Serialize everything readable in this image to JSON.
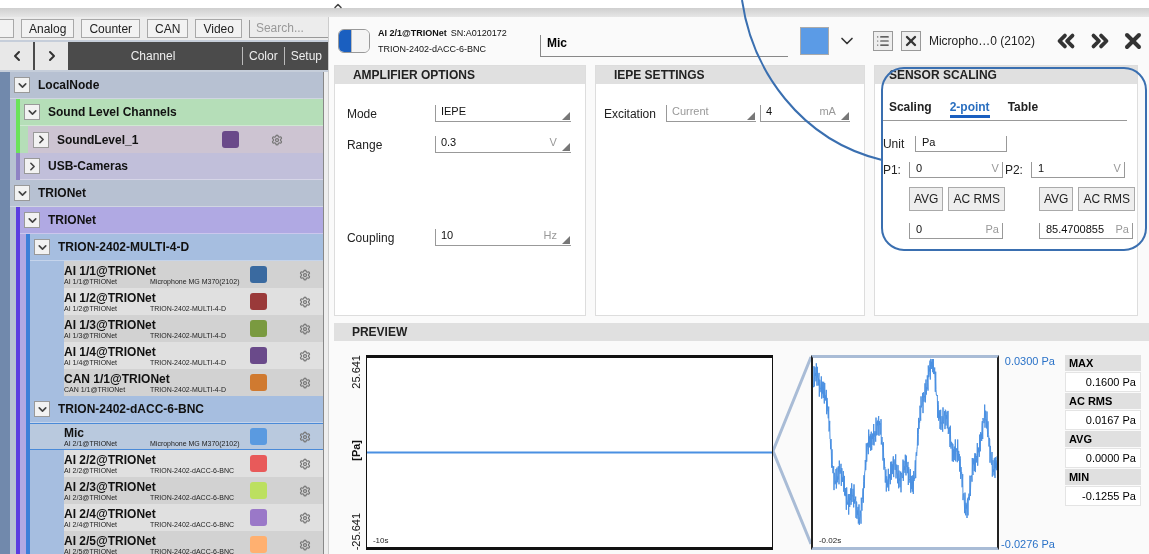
{
  "filters": {
    "buttons": [
      "Analog",
      "Counter",
      "CAN",
      "Video"
    ],
    "search": {
      "placeholder": "Search..."
    }
  },
  "channel_list": {
    "columns": [
      "Channel",
      "Color",
      "Setup"
    ],
    "tree": [
      {
        "kind": "group",
        "label": "LocalNode",
        "expanded": true,
        "color": "#7189ac",
        "children": [
          {
            "kind": "group",
            "label": "Sound Level Channels",
            "expanded": true,
            "color": "#6be35a",
            "children": [
              {
                "kind": "channel",
                "name": "SoundLevel_1",
                "expanded": false,
                "color": "#6a4a8a",
                "selected": false
              }
            ]
          },
          {
            "kind": "group",
            "label": "USB-Cameras",
            "expanded": false,
            "color": "#8f82c4"
          }
        ]
      },
      {
        "kind": "group",
        "label": "TRIONet",
        "expanded": true,
        "color": "#7189ac",
        "children": [
          {
            "kind": "group",
            "label": "TRIONet",
            "expanded": true,
            "color": "#5b3ce0",
            "children": [
              {
                "kind": "group",
                "label": "TRION-2402-MULTI-4-D",
                "expanded": true,
                "color": "#3c7fd8",
                "children": [
                  {
                    "kind": "channel",
                    "name": "AI 1/1@TRIONet",
                    "address": "AI 1/1@TRIONet",
                    "device": "Microphone MG M370(2102)",
                    "color": "#3a6aa0",
                    "selected": false
                  },
                  {
                    "kind": "channel",
                    "name": "AI 1/2@TRIONet",
                    "address": "AI 1/2@TRIONet",
                    "device": "TRION-2402-MULTI-4-D",
                    "color": "#9a3a3a",
                    "selected": false
                  },
                  {
                    "kind": "channel",
                    "name": "AI 1/3@TRIONet",
                    "address": "AI 1/3@TRIONet",
                    "device": "TRION-2402-MULTI-4-D",
                    "color": "#7a9a40",
                    "selected": false
                  },
                  {
                    "kind": "channel",
                    "name": "AI 1/4@TRIONet",
                    "address": "AI 1/4@TRIONet",
                    "device": "TRION-2402-MULTI-4-D",
                    "color": "#6a4a8a",
                    "selected": false
                  },
                  {
                    "kind": "channel",
                    "name": "CAN 1/1@TRIONet",
                    "address": "CAN 1/1@TRIONet",
                    "device": "TRION-2402-MULTI-4-D",
                    "color": "#d07a30",
                    "selected": false
                  }
                ]
              },
              {
                "kind": "group",
                "label": "TRION-2402-dACC-6-BNC",
                "expanded": true,
                "color": "#3c7fd8",
                "children": [
                  {
                    "kind": "channel",
                    "name": "Mic",
                    "address": "AI 2/1@TRIONet",
                    "device": "Microphone MG M370(2102)",
                    "color": "#5a9ae0",
                    "selected": true
                  },
                  {
                    "kind": "channel",
                    "name": "AI 2/2@TRIONet",
                    "address": "AI 2/2@TRIONet",
                    "device": "TRION-2402-dACC-6-BNC",
                    "color": "#e85a5a",
                    "selected": false
                  },
                  {
                    "kind": "channel",
                    "name": "AI 2/3@TRIONet",
                    "address": "AI 2/3@TRIONet",
                    "device": "TRION-2402-dACC-6-BNC",
                    "color": "#bce060",
                    "selected": false
                  },
                  {
                    "kind": "channel",
                    "name": "AI 2/4@TRIONet",
                    "address": "AI 2/4@TRIONet",
                    "device": "TRION-2402-dACC-6-BNC",
                    "color": "#9a78c8",
                    "selected": false
                  },
                  {
                    "kind": "channel",
                    "name": "AI 2/5@TRIONet",
                    "address": "AI 2/5@TRIONet",
                    "device": "TRION-2402-dACC-6-BNC",
                    "color": "#ffb070",
                    "selected": false
                  }
                ]
              }
            ]
          }
        ]
      }
    ]
  },
  "channel_header": {
    "enabled": true,
    "title": "AI 2/1@TRIONet",
    "serial": "SN:A0120172",
    "device": "TRION-2402-dACC-6-BNC",
    "name": "Mic",
    "color": "#5b9be6",
    "sensor": "Micropho…0 (2102)"
  },
  "amplifier_options": {
    "title": "AMPLIFIER OPTIONS",
    "fields": [
      {
        "label": "Mode",
        "value": "IEPE"
      },
      {
        "label": "Range",
        "value": "0.3",
        "unit": "V"
      },
      {
        "label": "Coupling",
        "value": "10",
        "unit": "Hz"
      }
    ]
  },
  "iepe_settings": {
    "title": "IEPE SETTINGS",
    "label": "Excitation",
    "mode": {
      "value": "Current",
      "disabled": true
    },
    "value": "4",
    "unit": "mA"
  },
  "sensor_scaling": {
    "title": "SENSOR SCALING",
    "tabs": [
      {
        "label": "Scaling",
        "selected": false
      },
      {
        "label": "2-point",
        "selected": true
      },
      {
        "label": "Table",
        "selected": false
      }
    ],
    "unit_label": "Unit",
    "unit": "Pa",
    "points": [
      {
        "label": "P1:",
        "value": "0",
        "unit": "V",
        "buttons": [
          "AVG",
          "AC RMS"
        ],
        "scaled": "0",
        "scaled_unit": "Pa"
      },
      {
        "label": "P2:",
        "value": "1",
        "unit": "V",
        "buttons": [
          "AVG",
          "AC RMS"
        ],
        "scaled": "85.4700855",
        "scaled_unit": "Pa"
      }
    ]
  },
  "preview": {
    "title": "PREVIEW",
    "y_max": "25.641",
    "y_unit": "[Pa]",
    "y_min": "-25.641",
    "time": "-10s",
    "zoom_time": "-0.02s",
    "zoom_max": "0.0300 Pa",
    "zoom_min": "-0.0276 Pa",
    "stats": [
      {
        "label": "MAX",
        "value": "0.1600 Pa"
      },
      {
        "label": "AC RMS",
        "value": "0.0167 Pa"
      },
      {
        "label": "AVG",
        "value": "0.0000 Pa"
      },
      {
        "label": "MIN",
        "value": "-0.1255 Pa"
      }
    ]
  }
}
